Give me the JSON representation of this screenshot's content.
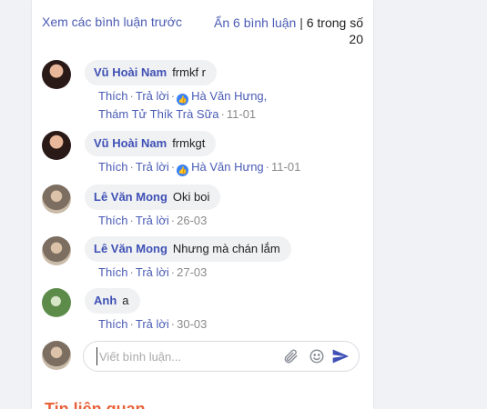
{
  "header": {
    "prev_link": "Xem các bình luận trước",
    "hide_link": "Ẩn 6 bình luận",
    "separator": "|",
    "count": "6 trong số 20"
  },
  "comments": [
    {
      "author": "Vũ Hoài Nam",
      "text": "frmkf r",
      "like": "Thích",
      "reply": "Trả lời",
      "likers_line1": "Hà Văn Hưng,",
      "likers_line2": "Thám Tử Thík Trà Sữa",
      "time": "11-01",
      "avatar": "dark"
    },
    {
      "author": "Vũ Hoài Nam",
      "text": "frmkgt",
      "like": "Thích",
      "reply": "Trả lời",
      "likers": "Hà Văn Hưng",
      "time": "11-01",
      "avatar": "dark"
    },
    {
      "author": "Lê Văn Mong",
      "text": "Oki boi",
      "like": "Thích",
      "reply": "Trả lời",
      "time": "26-03",
      "avatar": "mong"
    },
    {
      "author": "Lê Văn Mong",
      "text": "Nhưng mà chán lắm",
      "like": "Thích",
      "reply": "Trả lời",
      "time": "27-03",
      "avatar": "mong"
    },
    {
      "author": "Anh",
      "text": "a",
      "like": "Thích",
      "reply": "Trả lời",
      "time": "30-03",
      "avatar": "green"
    }
  ],
  "composer": {
    "placeholder": "Viết bình luận..."
  },
  "related_title": "Tin liên quan",
  "colors": {
    "accent": "#3f51b5",
    "link": "#4a5bb5",
    "section_title": "#e8623a",
    "like_badge": "#3b82f6"
  }
}
